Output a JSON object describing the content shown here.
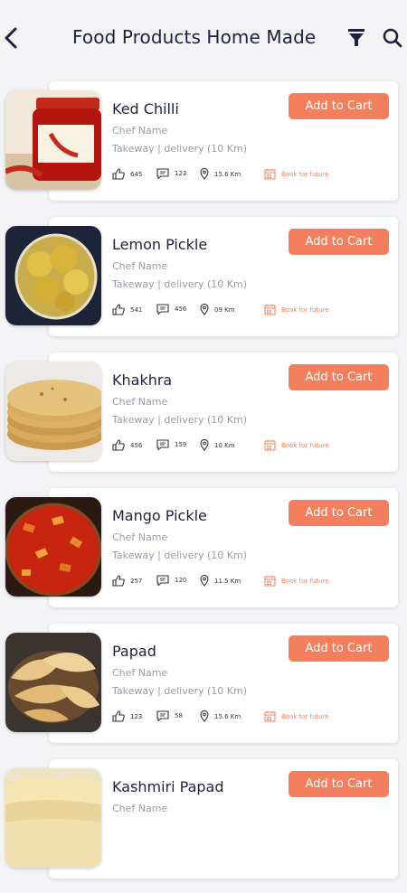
{
  "header": {
    "title": "Food Products Home Made",
    "back_icon": "chevron-left-icon",
    "filter_icon": "filter-icon",
    "search_icon": "search-icon"
  },
  "colors": {
    "accent": "#f47f5c",
    "title": "#1f2140",
    "muted": "#9a9aa6",
    "background": "#f3f3f6"
  },
  "products": [
    {
      "name": "Ked Chilli",
      "chef": "Chef Name",
      "mode": "Takeway | delivery (10 Km)",
      "cart_label": "Add to Cart",
      "likes": "645",
      "comments": "123",
      "distance": "15.6 Km",
      "book": "Book for future"
    },
    {
      "name": "Lemon Pickle",
      "chef": "Chef Name",
      "mode": "Takeway | delivery (10 Km)",
      "cart_label": "Add to Cart",
      "likes": "541",
      "comments": "456",
      "distance": "09 Km",
      "book": "Book for future"
    },
    {
      "name": "Khakhra",
      "chef": "Chef Name",
      "mode": "Takeway | delivery (10 Km)",
      "cart_label": "Add to Cart",
      "likes": "456",
      "comments": "159",
      "distance": "10 Km",
      "book": "Book for future"
    },
    {
      "name": "Mango Pickle",
      "chef": "Chef Name",
      "mode": "Takeway | delivery (10 Km)",
      "cart_label": "Add to Cart",
      "likes": "257",
      "comments": "120",
      "distance": "11.5 Km",
      "book": "Book for future"
    },
    {
      "name": "Papad",
      "chef": "Chef Name",
      "mode": "Takeway | delivery (10 Km)",
      "cart_label": "Add to Cart",
      "likes": "123",
      "comments": "58",
      "distance": "15.6 Km",
      "book": "Book for future"
    },
    {
      "name": "Kashmiri Papad",
      "chef": "Chef Name",
      "mode": "",
      "cart_label": "Add to Cart",
      "likes": "",
      "comments": "",
      "distance": "",
      "book": ""
    }
  ]
}
